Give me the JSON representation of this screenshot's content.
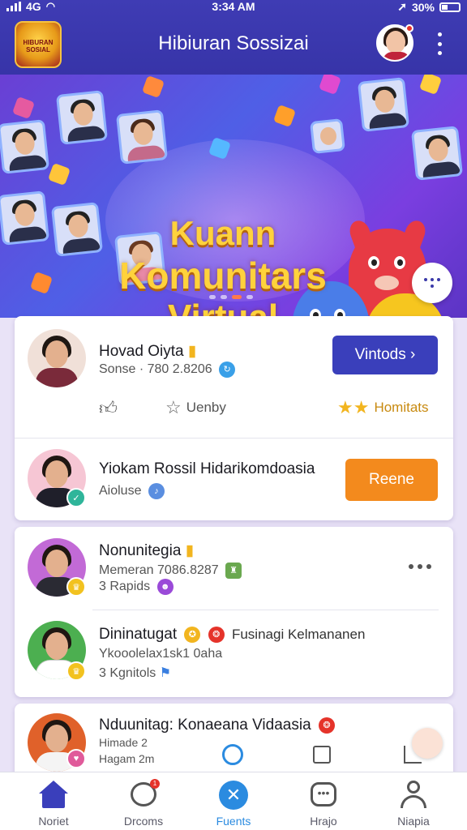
{
  "status_bar": {
    "signal": "4G",
    "time": "3:34 AM",
    "battery": "30%"
  },
  "header": {
    "logo_text": "HIBURAN SOSIAL",
    "title": "Hibiuran Sossizai"
  },
  "banner": {
    "line1": "Kuann",
    "line2": "Komunitars",
    "line3": "Virtual"
  },
  "featured": [
    {
      "name": "Hovad Oiyta",
      "sub": "Sonse · 780 2.8206",
      "button": "Vintods",
      "action_like": "",
      "action_rate": "Uenby",
      "action_stars": "Homitats"
    },
    {
      "name": "Yiokam Rossil Hidarikomdoasia",
      "sub": "Aioluse",
      "button": "Reene"
    }
  ],
  "list": [
    {
      "name": "Nonunitegia",
      "line2": "Memeran 7086.8287",
      "line3": "3 Rapids"
    },
    {
      "name": "Dininatugat",
      "extra": "Fusinagi Kelmananen",
      "line2": "Ykooolelax1sk1 0aha",
      "line3": "3 Kgnitols"
    },
    {
      "name": "Nduunitag: Konaeana Vidaasia",
      "line2": "Himade 2",
      "line3": "Hagam 2m"
    }
  ],
  "bottom_nav": [
    {
      "label": "Noriet",
      "icon": "home-icon",
      "active": false
    },
    {
      "label": "Drcoms",
      "icon": "chat-bubble-icon",
      "active": false,
      "badge": "1"
    },
    {
      "label": "Fuents",
      "icon": "events-icon",
      "active": true
    },
    {
      "label": "Hrajo",
      "icon": "message-icon",
      "active": false
    },
    {
      "label": "Niapia",
      "icon": "profile-icon",
      "active": false
    }
  ],
  "colors": {
    "header": "#3a37ab",
    "primary_button": "#3a3fbb",
    "secondary_button": "#f38a1d",
    "active_nav": "#2b8be0"
  }
}
